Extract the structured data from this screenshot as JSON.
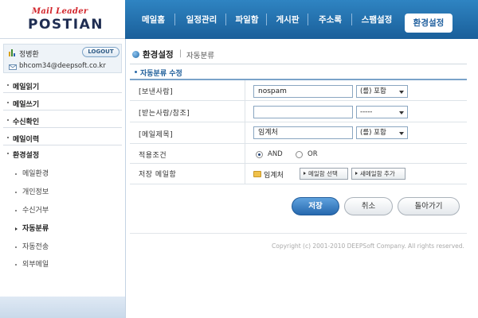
{
  "logo": {
    "tagline": "Mail Leader",
    "name": "POSTIAN"
  },
  "topnav": [
    {
      "label": "메일홈"
    },
    {
      "label": "일정관리"
    },
    {
      "label": "파일함"
    },
    {
      "label": "게시판"
    },
    {
      "label": "주소록"
    },
    {
      "label": "스팸설정"
    },
    {
      "label": "환경설정",
      "active": true
    }
  ],
  "user": {
    "name": "정병환",
    "email": "bhcom34@deepsoft.co.kr",
    "logout_label": "LOGOUT"
  },
  "sidebar": {
    "main_items": [
      {
        "label": "메일읽기"
      },
      {
        "label": "메일쓰기"
      },
      {
        "label": "수신확인"
      },
      {
        "label": "메일이력"
      },
      {
        "label": "환경설정"
      }
    ],
    "sub_items": [
      {
        "label": "메일환경"
      },
      {
        "label": "개인정보"
      },
      {
        "label": "수신거부"
      },
      {
        "label": "자동분류",
        "active": true
      },
      {
        "label": "자동전송"
      },
      {
        "label": "외부메일"
      }
    ]
  },
  "page": {
    "title": "환경설정",
    "breadcrumb": "자동분류",
    "section_title": "자동분류 수정"
  },
  "form": {
    "sender": {
      "label": "[보낸사람]",
      "value": "nospam",
      "condition": "(를) 포함"
    },
    "recipient": {
      "label": "[받는사람/참조]",
      "value": "",
      "condition": "-----"
    },
    "subject": {
      "label": "[메일제목]",
      "value": "임계처",
      "condition": "(를) 포함"
    },
    "apply_condition": {
      "label": "적용조건",
      "options": [
        "AND",
        "OR"
      ],
      "selected": "AND"
    },
    "save_folder": {
      "label": "저장 메일함",
      "folder": "임계처",
      "select_button": "메일함 선택",
      "new_button": "새메일함 추가"
    }
  },
  "buttons": {
    "save": "저장",
    "cancel": "취소",
    "back": "돌아가기"
  },
  "footer": {
    "copyright": "Copyright (c) 2001-2010 DEEPSoft Company. All rights reserved."
  },
  "colors": {
    "topbar": "#1f6fae",
    "accent": "#2668ae",
    "logo_red": "#d2242a"
  }
}
